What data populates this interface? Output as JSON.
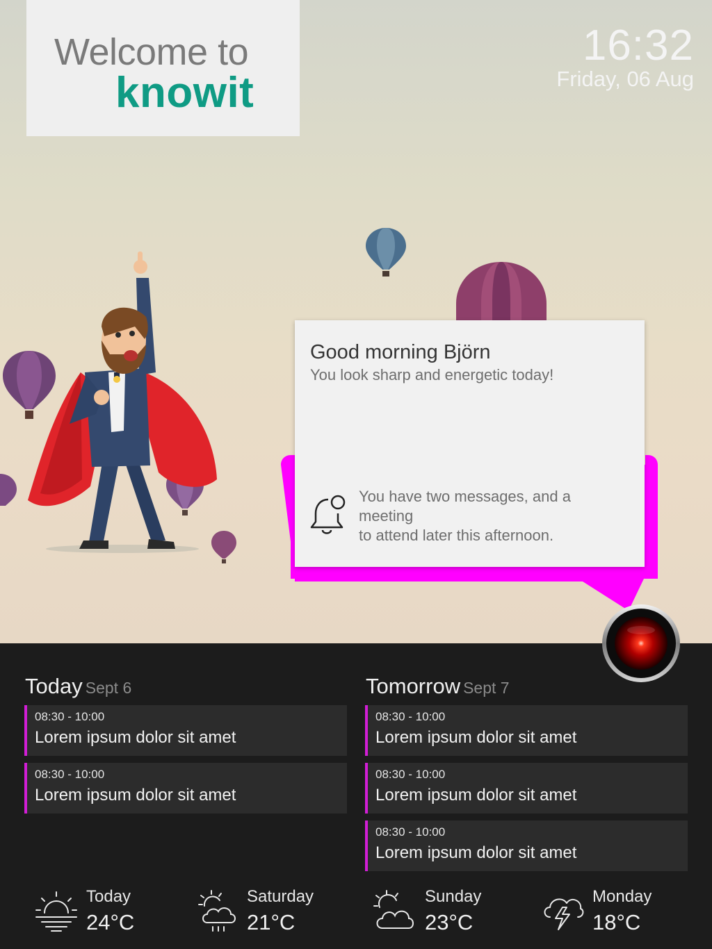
{
  "header": {
    "welcome": "Welcome to",
    "brand": "knowit",
    "time": "16:32",
    "date": "Friday, 06 Aug"
  },
  "assistant": {
    "greeting": "Good morning Björn",
    "subtitle": "You look sharp and energetic today!",
    "notification": "You have two messages, and a meeting\nto attend later this afternoon.",
    "accent_color": "#ff00ff",
    "eye_color": "#ff1a1a"
  },
  "agenda": {
    "today": {
      "label": "Today",
      "date": "Sept 6",
      "events": [
        {
          "time": "08:30 - 10:00",
          "title": "Lorem ipsum dolor sit amet"
        },
        {
          "time": "08:30 - 10:00",
          "title": "Lorem ipsum dolor sit amet"
        }
      ]
    },
    "tomorrow": {
      "label": "Tomorrow",
      "date": "Sept 7",
      "events": [
        {
          "time": "08:30 - 10:00",
          "title": "Lorem ipsum dolor sit amet"
        },
        {
          "time": "08:30 - 10:00",
          "title": "Lorem ipsum dolor sit amet"
        },
        {
          "time": "08:30 - 10:00",
          "title": "Lorem ipsum dolor sit amet"
        }
      ]
    },
    "event_accent": "#d21ed6"
  },
  "weather": [
    {
      "day": "Today",
      "temp": "24°C",
      "icon": "sunrise-icon"
    },
    {
      "day": "Saturday",
      "temp": "21°C",
      "icon": "partly-cloudy-rain-icon"
    },
    {
      "day": "Sunday",
      "temp": "23°C",
      "icon": "partly-cloudy-icon"
    },
    {
      "day": "Monday",
      "temp": "18°C",
      "icon": "thunderstorm-icon"
    }
  ]
}
